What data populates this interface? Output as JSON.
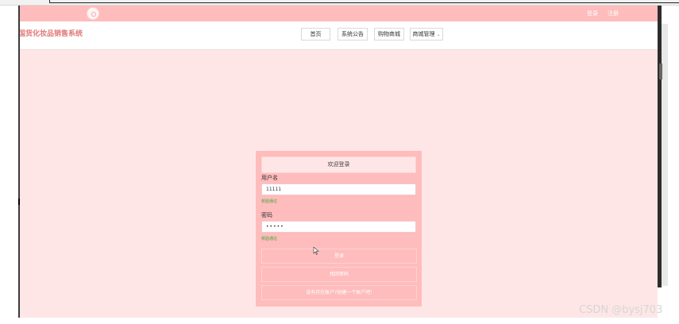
{
  "topbar": {
    "login_link": "登录",
    "register_link": "注册"
  },
  "navbar": {
    "site_title": "国货化妆品销售系统",
    "items": [
      {
        "label": "首页"
      },
      {
        "label": "系统公告"
      },
      {
        "label": "购物商城"
      },
      {
        "label": "商城管理"
      }
    ]
  },
  "login": {
    "title": "欢迎登录",
    "username_label": "用户名",
    "username_value": "11111",
    "username_status": "校验通过",
    "password_label": "密码",
    "password_value": "•••••",
    "password_status": "校验通过",
    "login_button": "登录",
    "forgot_button": "找回密码",
    "register_button": "没有存在账户?创建一个账户吧!"
  },
  "icons": {
    "logo": "logo-icon",
    "chevron": "chevron-down-icon",
    "cursor": "mouse-cursor-icon"
  },
  "colors": {
    "topbar": "#ffbcbc",
    "background": "#ffe6e6",
    "title": "#e07a7a",
    "valid": "#3aa83a"
  },
  "watermark": "CSDN @bysj703"
}
